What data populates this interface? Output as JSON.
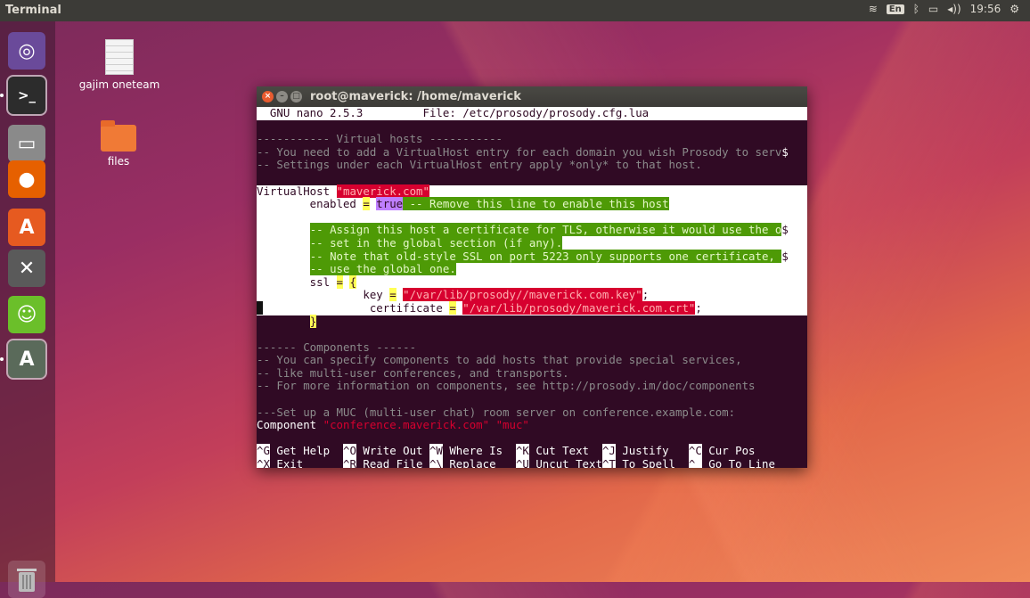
{
  "top_panel": {
    "title": "Terminal",
    "lang": "En",
    "clock": "19:56"
  },
  "launcher": {
    "items": [
      {
        "name": "ubuntu-dash",
        "glyph": "◎",
        "color": "#6a4a9a"
      },
      {
        "name": "terminal",
        "glyph": ">_",
        "color": "#2c2c2c"
      },
      {
        "name": "files",
        "glyph": "▭",
        "color": "#8a8a8a"
      },
      {
        "name": "firefox",
        "glyph": "●",
        "color": "#e66000"
      },
      {
        "name": "software-center",
        "glyph": "A",
        "color": "#e65a20"
      },
      {
        "name": "system-settings",
        "glyph": "✕",
        "color": "#5a5a5a"
      },
      {
        "name": "user-accounts",
        "glyph": "☺",
        "color": "#6bbf2a"
      },
      {
        "name": "software-updater",
        "glyph": "A",
        "color": "#5a6a5a"
      }
    ],
    "trash_icon": "trash-icon"
  },
  "desktop": {
    "icons": [
      {
        "label": "gajim oneteam",
        "type": "document"
      },
      {
        "label": "files",
        "type": "folder"
      }
    ]
  },
  "window": {
    "title": "root@maverick: /home/maverick"
  },
  "nano": {
    "header": "  GNU nano 2.5.3         File: /etc/prosody/prosody.cfg.lua",
    "lines": {
      "l1": "----------- Virtual hosts -----------",
      "l2": "-- You need to add a VirtualHost entry for each domain you wish Prosody to serv",
      "l2end": "$",
      "l3": "-- Settings under each VirtualHost entry apply *only* to that host.",
      "vh_kw": "VirtualHost ",
      "vh_val": "\"maverick.com\"",
      "en_indent": "        enabled ",
      "en_eq": "=",
      "en_sp": " ",
      "en_true": "true",
      "en_comment": " -- Remove this line to enable this host",
      "c1": "-- Assign this host a certificate for TLS, otherwise it would use the o",
      "c1end": "$",
      "c2": "-- set in the global section (if any).",
      "c3": "-- Note that old-style SSL on port 5223 only supports one certificate, ",
      "c3end": "$",
      "c4": "-- use the global one.",
      "ssl_kw": "        ssl ",
      "ssl_eq": "=",
      "ssl_brace": "{",
      "key_kw": "                key ",
      "key_eq": "=",
      "key_val": "\"/var/lib/prosody//maverick.com.key\"",
      "key_end": ";",
      "cert_kw": "                certificate ",
      "cert_eq": "=",
      "cert_val": "\"/var/lib/prosody/maverick.com.crt\"",
      "cert_end": ";",
      "close_brace": "}",
      "comp1": "------ Components ------",
      "comp2": "-- You can specify components to add hosts that provide special services,",
      "comp3": "-- like multi-user conferences, and transports.",
      "comp4": "-- For more information on components, see http://prosody.im/doc/components",
      "muc1": "---Set up a MUC (multi-user chat) room server on conference.example.com:",
      "comp_kw": "Component ",
      "comp_val": "\"conference.maverick.com\" \"muc\""
    },
    "shortcuts_row1": [
      {
        "key": "^G",
        "label": " Get Help  "
      },
      {
        "key": "^O",
        "label": " Write Out "
      },
      {
        "key": "^W",
        "label": " Where Is  "
      },
      {
        "key": "^K",
        "label": " Cut Text  "
      },
      {
        "key": "^J",
        "label": " Justify   "
      },
      {
        "key": "^C",
        "label": " Cur Pos"
      }
    ],
    "shortcuts_row2": [
      {
        "key": "^X",
        "label": " Exit      "
      },
      {
        "key": "^R",
        "label": " Read File "
      },
      {
        "key": "^\\",
        "label": " Replace   "
      },
      {
        "key": "^U",
        "label": " Uncut Text"
      },
      {
        "key": "^T",
        "label": " To Spell  "
      },
      {
        "key": "^_",
        "label": " Go To Line"
      }
    ]
  }
}
